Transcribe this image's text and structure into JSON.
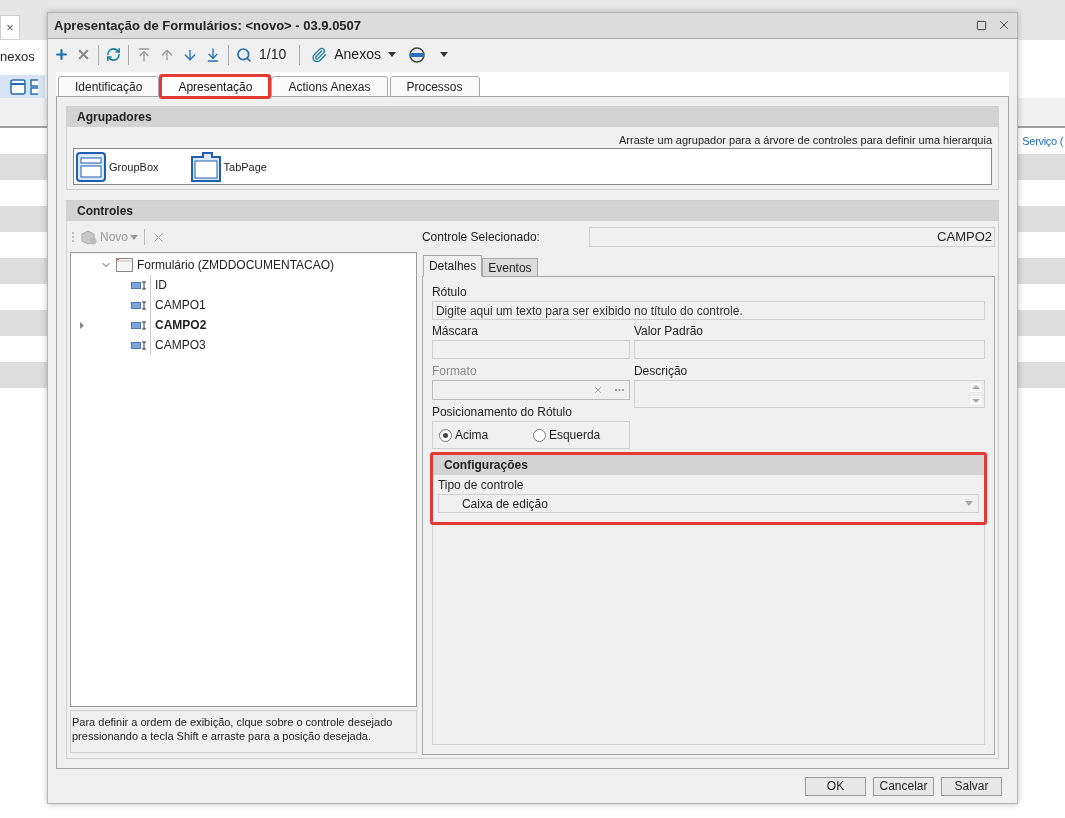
{
  "background": {
    "tab_close": "×",
    "toolbar_label": "nexos",
    "link": "Serviço ("
  },
  "window": {
    "title": "Apresentação de Formulários: <novo> - 03.9.0507"
  },
  "toolbar": {
    "record_counter": "1/10",
    "attachments": "Anexos"
  },
  "tabs": [
    {
      "label": "Identificação",
      "selected": false,
      "highlighted": false
    },
    {
      "label": "Apresentação",
      "selected": true,
      "highlighted": true
    },
    {
      "label": "Actions Anexas",
      "selected": false,
      "highlighted": false
    },
    {
      "label": "Processos",
      "selected": false,
      "highlighted": false
    }
  ],
  "groupers": {
    "title": "Agrupadores",
    "hint": "Arraste um agrupador para a árvore de controles para definir uma hierarquia",
    "items": [
      {
        "label": "GroupBox",
        "kind": "groupbox"
      },
      {
        "label": "TabPage",
        "kind": "tabpage"
      }
    ]
  },
  "controls": {
    "title": "Controles",
    "new_button": "Novo",
    "tree": [
      {
        "label": "Formulário (ZMDDOCUMENTACAO)",
        "expanded": true,
        "selected": false,
        "children": [
          {
            "label": "ID",
            "selected": false
          },
          {
            "label": "CAMPO1",
            "selected": false
          },
          {
            "label": "CAMPO2",
            "selected": true
          },
          {
            "label": "CAMPO3",
            "selected": false
          }
        ]
      }
    ],
    "help": "Para definir a ordem de exibição, clque sobre o controle desejado pressionando a tecla Shift e arraste para a posição desejada."
  },
  "selected_control": {
    "label": "Controle Selecionado:",
    "value": "CAMPO2"
  },
  "detail_tabs": [
    {
      "label": "Detalhes",
      "selected": true
    },
    {
      "label": "Eventos",
      "selected": false
    }
  ],
  "details": {
    "caption": {
      "label": "Rótulo",
      "placeholder": "Digite aqui um texto para ser exibido no título do controle."
    },
    "mask": {
      "label": "Máscara"
    },
    "default_value": {
      "label": "Valor Padrão"
    },
    "format": {
      "label": "Formato",
      "disabled": true
    },
    "description": {
      "label": "Descrição"
    },
    "label_position": {
      "label": "Posicionamento do Rótulo",
      "options": [
        {
          "label": "Acima",
          "selected": true
        },
        {
          "label": "Esquerda",
          "selected": false
        }
      ]
    }
  },
  "settings": {
    "title": "Configurações",
    "highlighted": true,
    "control_type": {
      "label": "Tipo de controle",
      "value": "Caixa de edição"
    }
  },
  "buttons": [
    "OK",
    "Cancelar",
    "Salvar"
  ]
}
